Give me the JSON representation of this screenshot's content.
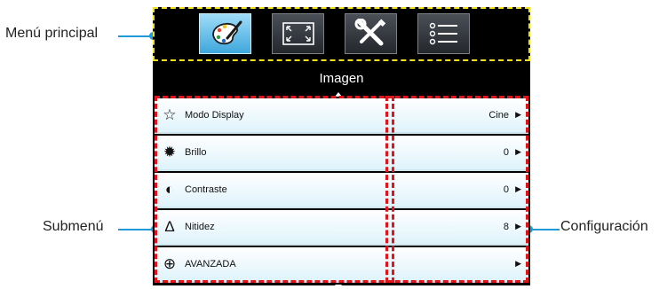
{
  "callouts": {
    "main_menu": "Menú principal",
    "submenu": "Submenú",
    "settings": "Configuración"
  },
  "tabs": [
    {
      "icon": "palette-icon",
      "active": true
    },
    {
      "icon": "screen-expand-icon",
      "active": false
    },
    {
      "icon": "tools-icon",
      "active": false
    },
    {
      "icon": "list-icon",
      "active": false
    }
  ],
  "menu_title": "Imagen",
  "rows": [
    {
      "icon": "star-icon",
      "label": "Modo Display",
      "value": "Cine"
    },
    {
      "icon": "brightness-icon",
      "label": "Brillo",
      "value": "0"
    },
    {
      "icon": "contrast-icon",
      "label": "Contraste",
      "value": "0"
    },
    {
      "icon": "sharpness-icon",
      "label": "Nitidez",
      "value": "8"
    },
    {
      "icon": "advanced-icon",
      "label": "AVANZADA",
      "value": ""
    }
  ],
  "colors": {
    "accent": "#1e9ad6",
    "highlight_dash": "#f2e11a",
    "submenu_dash": "#e0141b",
    "active_tab": "#3ea7dc"
  }
}
